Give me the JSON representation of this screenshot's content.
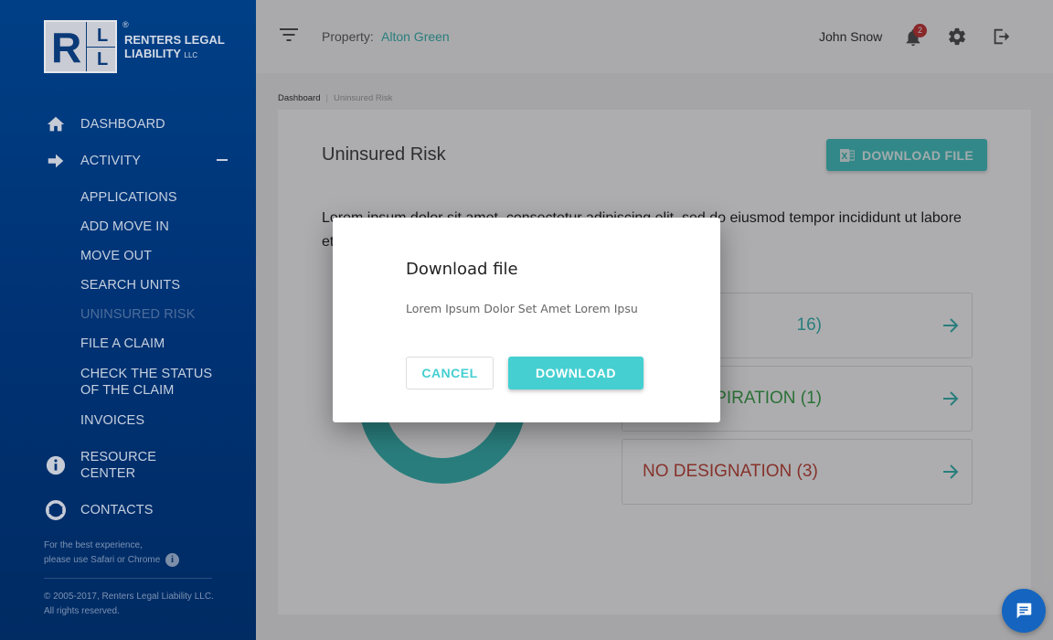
{
  "brand": {
    "logo_letters": [
      "R",
      "L",
      "L"
    ],
    "name_line1": "RENTERS LEGAL",
    "name_line2": "LIABILITY",
    "suffix": "LLC",
    "registered": "®"
  },
  "sidebar": {
    "items": [
      {
        "label": "DASHBOARD",
        "icon": "home-icon"
      },
      {
        "label": "ACTIVITY",
        "icon": "arrow-right-icon",
        "expanded": true
      },
      {
        "label": "APPLICATIONS"
      },
      {
        "label": "ADD MOVE IN"
      },
      {
        "label": "MOVE OUT"
      },
      {
        "label": "SEARCH UNITS"
      },
      {
        "label": "UNINSURED RISK",
        "active": true
      },
      {
        "label": "FILE A CLAIM"
      },
      {
        "label": "CHECK THE STATUS\nOF THE CLAIM"
      },
      {
        "label": "INVOICES"
      },
      {
        "label": "RESOURCE\nCENTER",
        "icon": "info-icon"
      },
      {
        "label": "CONTACTS",
        "icon": "lifebuoy-icon"
      }
    ],
    "browser_note_line1": "For the best experience,",
    "browser_note_line2": "please use Safari or Chrome",
    "copyright_line1": "© 2005-2017, Renters Legal Liability LLC.",
    "copyright_line2": "All rights reserved."
  },
  "header": {
    "property_label": "Property:",
    "property_value": "Alton Green",
    "user_name": "John Snow",
    "notification_count": "2"
  },
  "breadcrumb": {
    "items": [
      "Dashboard",
      "Uninsured Risk"
    ]
  },
  "page": {
    "title": "Uninsured Risk",
    "download_button": "DOWNLOAD FILE",
    "description_line1": "Lorem ipsum dolor sit amet, consectetur adipiscing elit, sed do eiusmod tempor incididunt ut labore",
    "description_line2": "et",
    "risk_items": [
      {
        "visible_label": "16)",
        "color": "#2bb3ae"
      },
      {
        "visible_label": "PIRATION (1)",
        "color": "#2e9e3e"
      },
      {
        "visible_label": "NO DESIGNATION (3)",
        "color": "#c0392b"
      }
    ],
    "donut_color": "#2bb3ae"
  },
  "modal": {
    "title": "Download file",
    "body": "Lorem Ipsum Dolor Set Amet Lorem Ipsu",
    "cancel_label": "CANCEL",
    "download_label": "DOWNLOAD"
  }
}
